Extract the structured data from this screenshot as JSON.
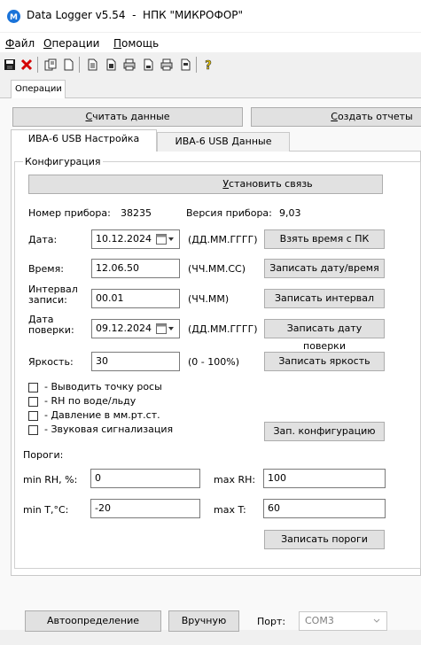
{
  "window": {
    "title": "Data Logger v5.54  -  НПК \"МИКРОФОР\""
  },
  "menu": [
    {
      "accel": "Ф",
      "rest": "айл"
    },
    {
      "accel": "О",
      "rest": "перации"
    },
    {
      "accel": "П",
      "rest": "омощь"
    }
  ],
  "toolbar": {
    "icons": [
      "save-icon",
      "close-x-icon",
      "copy-icon",
      "new-file-icon",
      "document-icon",
      "document-alt-icon",
      "printer-icon",
      "print-preview-icon",
      "printer-alt-icon",
      "report-icon",
      "help-icon"
    ],
    "colors": {
      "close": "#d40000",
      "help": "#e8c600"
    }
  },
  "outer_tab": {
    "label": "Операции"
  },
  "actions": {
    "read": {
      "accel": "С",
      "rest": "читать данные"
    },
    "report": {
      "accel": "С",
      "rest": "оздать отчеты"
    }
  },
  "inner_tabs": [
    {
      "label": "ИВА-6 USB Настройка",
      "active": true
    },
    {
      "label": "ИВА-6 USB Данные",
      "active": false
    }
  ],
  "config": {
    "group_title": "Конфигурация",
    "connect": {
      "accel": "У",
      "rest": "становить связь"
    },
    "device_number_label": "Номер прибора:",
    "device_number": "38235",
    "version_label": "Версия прибора:",
    "version": "9,03",
    "date_label": "Дата:",
    "date_value": "10.12.2024",
    "date_format": "(ДД.ММ.ГГГГ)",
    "btn_pc_time": "Взять время с ПК",
    "time_label": "Время:",
    "time_value": "12.06.50",
    "time_format": "(ЧЧ.ММ.СС)",
    "btn_write_datetime": "Записать дату/время",
    "interval_label_1": "Интервал",
    "interval_label_2": "записи:",
    "interval_value": "00.01",
    "interval_format": "(ЧЧ.ММ)",
    "btn_write_interval": "Записать интервал",
    "verify_label_1": "Дата",
    "verify_label_2": "поверки:",
    "verify_value": "09.12.2024",
    "verify_format": "(ДД.ММ.ГГГГ)",
    "btn_write_verify": "Записать дату поверки",
    "brightness_label": "Яркость:",
    "brightness_value": "30",
    "brightness_range": "(0 - 100%)",
    "btn_write_brightness": "Записать яркость",
    "checkboxes": [
      {
        "label": "-  Выводить точку росы",
        "checked": false
      },
      {
        "label": "-  RH по воде/льду",
        "checked": false
      },
      {
        "label": "-  Давление в мм.рт.ст.",
        "checked": false
      },
      {
        "label": "-  Звуковая сигнализация",
        "checked": false
      }
    ],
    "btn_write_config": "Зап. конфигурацию"
  },
  "thresholds": {
    "title": "Пороги:",
    "min_rh_label": "min RH, %:",
    "min_rh": "0",
    "max_rh_label": "max RH:",
    "max_rh": "100",
    "min_t_label": "min T,°C:",
    "min_t": "-20",
    "max_t_label": "max T:",
    "max_t": "60",
    "btn_write": "Записать пороги"
  },
  "bottom": {
    "btn_auto": "Автоопределение",
    "btn_manual": "Вручную",
    "port_label": "Порт:",
    "port_value": "COM3"
  }
}
